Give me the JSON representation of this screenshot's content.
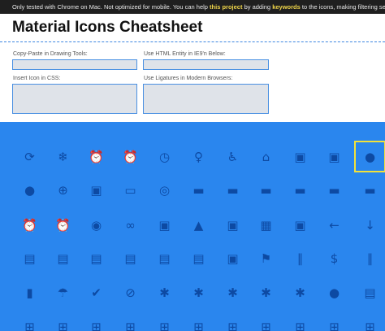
{
  "notice": {
    "prefix": "Only tested with Chrome on Mac. Not optimized for mobile. You can help ",
    "link1": "this project",
    "middle": " by adding ",
    "link2": "keywords",
    "suffix": " to the icons, making filtering search"
  },
  "page": {
    "title": "Material Icons Cheatsheet"
  },
  "fields": {
    "drawing_tools_label": "Copy-Paste in Drawing Tools:",
    "html_entity_label": "Use HTML Entity in IE9'n Below:",
    "css_label": "Insert Icon in CSS:",
    "ligatures_label": "Use Ligatures in Modern Browsers:"
  },
  "colors": {
    "grid_bg": "#2a86ee",
    "icon": "#0d4aa3",
    "selection": "#f2e23a",
    "input_border": "#4a90e2"
  },
  "icons": [
    [
      "3d-rotation-icon",
      "ac-unit-icon",
      "access-alarm-icon",
      "access-alarms-icon",
      "access-time-icon",
      "accessibility-icon",
      "accessible-icon",
      "account-balance-icon",
      "account-balance-wallet-icon",
      "account-box-icon",
      "account-circle-icon"
    ],
    [
      "add-location-icon",
      "add-shopping-cart-icon",
      "add-to-photos-icon",
      "add-to-queue-icon",
      "adjust-icon",
      "airline-seat-flat-icon",
      "airline-seat-flat-angled-icon",
      "airline-seat-individual-suite-icon",
      "airline-seat-legroom-extra-icon",
      "airline-seat-legroom-normal-icon",
      "airline-seat-legroom-reduced-icon"
    ],
    [
      "alarm-off-icon",
      "alarm-on-icon",
      "album-icon",
      "all-inclusive-icon",
      "all-out-icon",
      "android-icon",
      "announcement-icon",
      "apps-icon",
      "archive-icon",
      "arrow-back-icon",
      "arrow-downward-icon"
    ],
    [
      "assignment-icon",
      "assignment-ind-icon",
      "assignment-late-icon",
      "assignment-return-icon",
      "assignment-returned-icon",
      "assignment-turned-in-icon",
      "assistant-icon",
      "assistant-photo-icon",
      "attach-file-icon",
      "attach-money-icon",
      "attachment-icon"
    ],
    [
      "battery-charging-icon",
      "beach-access-icon",
      "beenhere-icon",
      "block-icon",
      "bluetooth-icon",
      "bluetooth-audio-icon",
      "bluetooth-connected-icon",
      "bluetooth-disabled-icon",
      "bluetooth-searching-icon",
      "blur-circular-icon",
      "blur-linear-icon"
    ],
    [
      "border-all-icon",
      "border-bottom-icon",
      "border-clear-icon",
      "border-color-icon",
      "border-horizontal-icon",
      "border-inner-icon",
      "border-left-icon",
      "border-outer-icon",
      "border-right-icon",
      "border-style-icon",
      "border-top-icon"
    ]
  ],
  "glyphs": [
    [
      "⟳",
      "❄",
      "⏰",
      "⏰",
      "◷",
      "♀",
      "♿",
      "⌂",
      "▣",
      "▣",
      "●"
    ],
    [
      "●",
      "⊕",
      "▣",
      "▭",
      "◎",
      "▬",
      "▬",
      "▬",
      "▬",
      "▬",
      "▬"
    ],
    [
      "⏰",
      "⏰",
      "◉",
      "∞",
      "▣",
      "▲",
      "▣",
      "▦",
      "▣",
      "←",
      "↓"
    ],
    [
      "▤",
      "▤",
      "▤",
      "▤",
      "▤",
      "▤",
      "▣",
      "⚑",
      "∥",
      "$",
      "∥"
    ],
    [
      "▮",
      "☂",
      "✔",
      "⊘",
      "✱",
      "✱",
      "✱",
      "✱",
      "✱",
      "●",
      "▤"
    ],
    [
      "⊞",
      "⊞",
      "⊞",
      "⊞",
      "⊞",
      "⊞",
      "⊞",
      "⊞",
      "⊞",
      "⊞",
      "⊞"
    ]
  ],
  "selected_cell": {
    "row": 0,
    "col": 10
  }
}
